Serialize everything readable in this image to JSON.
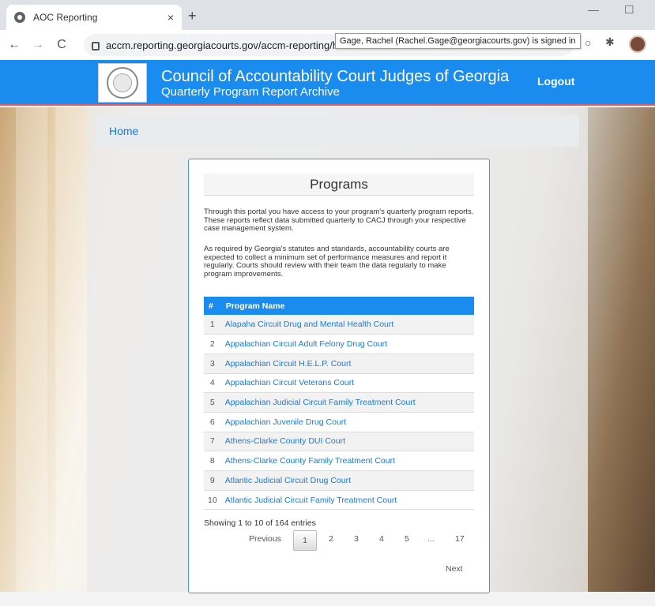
{
  "browser": {
    "tab_title": "AOC Reporting",
    "tab_close": "×",
    "new_tab": "+",
    "url": "accm.reporting.georgiacourts.gov/accm-reporting/ho",
    "signed_in_tooltip": "Gage, Rachel (Rachel.Gage@georgiacourts.gov) is signed in",
    "back": "←",
    "forward": "→",
    "reload": "C",
    "star": "☆"
  },
  "header": {
    "title": "Council of Accountability Court Judges of Georgia",
    "subtitle": "Quarterly Program Report Archive",
    "logout": "Logout"
  },
  "breadcrumb": {
    "home": "Home"
  },
  "programs": {
    "title": "Programs",
    "intro_1": "Through this portal you have access to your program's quarterly program reports. These reports reflect data submitted quarterly to CACJ through your respective case management system.",
    "intro_2": "As required by Georgia's statutes and standards, accountability courts are expected to collect a minimum set of performance measures and report it regularly. Courts should review with their team the data regularly to make program improvements.",
    "columns": [
      "#",
      "Program Name"
    ],
    "rows": [
      {
        "num": "1",
        "name": "Alapaha Circuit Drug and Mental Health Court"
      },
      {
        "num": "2",
        "name": "Appalachian Circuit Adult Felony Drug Court"
      },
      {
        "num": "3",
        "name": "Appalachian Circuit H.E.L.P. Court"
      },
      {
        "num": "4",
        "name": "Appalachian Circuit Veterans Court"
      },
      {
        "num": "5",
        "name": "Appalachian Judicial Circuit Family Treatment Court"
      },
      {
        "num": "6",
        "name": "Appalachian Juvenile Drug Court"
      },
      {
        "num": "7",
        "name": "Athens-Clarke County DUI Court"
      },
      {
        "num": "8",
        "name": "Athens-Clarke County Family Treatment Court"
      },
      {
        "num": "9",
        "name": "Atlantic Judicial Circuit Drug Court"
      },
      {
        "num": "10",
        "name": "Atlantic Judicial Circuit Family Treatment Court"
      }
    ],
    "info": "Showing 1 to 10 of 164 entries",
    "pagination": {
      "previous": "Previous",
      "pages": [
        "1",
        "2",
        "3",
        "4",
        "5",
        "...",
        "17"
      ],
      "next": "Next"
    }
  }
}
